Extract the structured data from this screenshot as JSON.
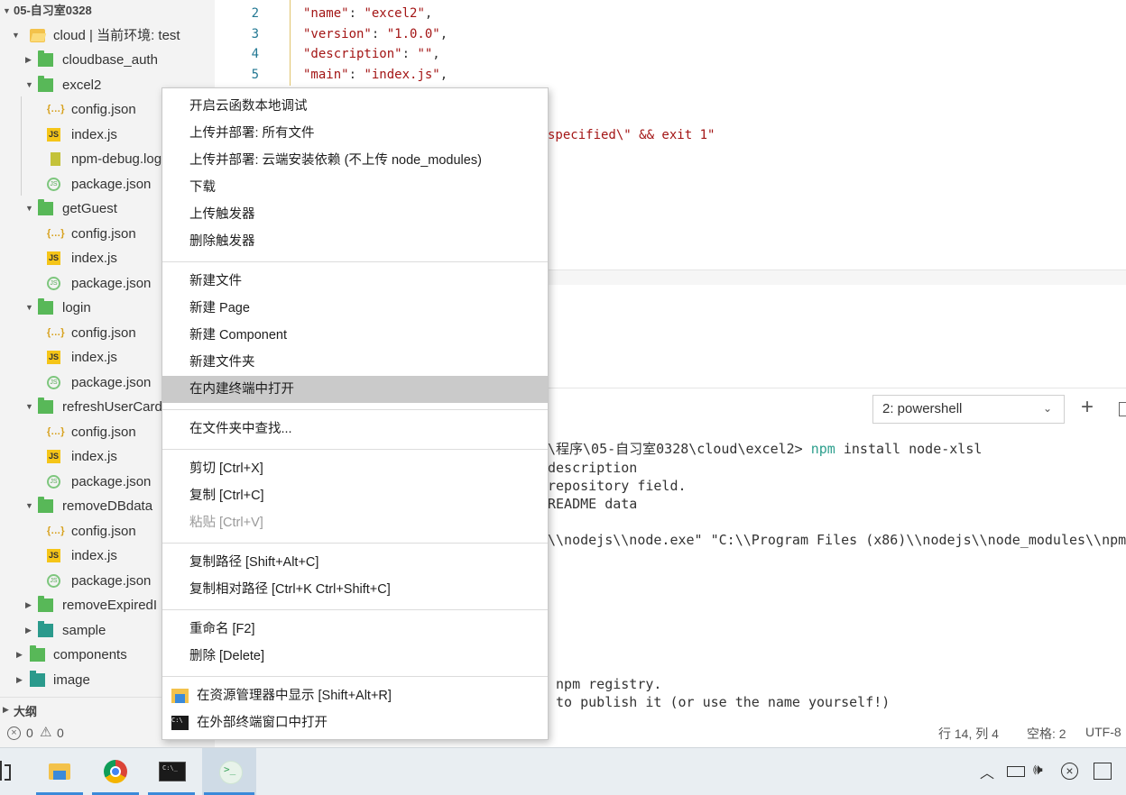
{
  "sidebar": {
    "project_title": "05-自习室0328",
    "cloud_root": "cloud | 当前环境: test",
    "items": [
      {
        "label": "cloudbase_auth"
      },
      {
        "label": "excel2"
      },
      {
        "label": "config.json"
      },
      {
        "label": "index.js"
      },
      {
        "label": "npm-debug.log"
      },
      {
        "label": "package.json"
      },
      {
        "label": "getGuest"
      },
      {
        "label": "config.json"
      },
      {
        "label": "index.js"
      },
      {
        "label": "package.json"
      },
      {
        "label": "login"
      },
      {
        "label": "config.json"
      },
      {
        "label": "index.js"
      },
      {
        "label": "package.json"
      },
      {
        "label": "refreshUserCard"
      },
      {
        "label": "config.json"
      },
      {
        "label": "index.js"
      },
      {
        "label": "package.json"
      },
      {
        "label": "removeDBdata"
      },
      {
        "label": "config.json"
      },
      {
        "label": "index.js"
      },
      {
        "label": "package.json"
      },
      {
        "label": "removeExpiredI"
      },
      {
        "label": "sample"
      },
      {
        "label": "components"
      },
      {
        "label": "image"
      }
    ],
    "outline_label": "大纲",
    "errors": "0",
    "warnings": "0"
  },
  "editor": {
    "lines": [
      {
        "num": "2",
        "key": "\"name\"",
        "val": "\"excel2\""
      },
      {
        "num": "3",
        "key": "\"version\"",
        "val": "\"1.0.0\""
      },
      {
        "num": "4",
        "key": "\"description\"",
        "val": "\"\""
      },
      {
        "num": "5",
        "key": "\"main\"",
        "val": "\"index.js\""
      }
    ],
    "partial_line": "specified\\\" && exit 1\""
  },
  "terminal": {
    "selector_value": "2: powershell",
    "add_symbol": "+",
    "lines": [
      {
        "prefix": "\\程序\\05-自习室0328\\cloud\\excel2> ",
        "cmd": "npm",
        "rest": " install node-xlsl"
      },
      {
        "prefix": "description",
        "cmd": "",
        "rest": ""
      },
      {
        "prefix": "repository field.",
        "cmd": "",
        "rest": ""
      },
      {
        "prefix": "README data",
        "cmd": "",
        "rest": ""
      },
      {
        "prefix": "\\\\nodejs\\\\node.exe\" \"C:\\\\Program Files (x86)\\\\nodejs\\\\node_modules\\\\npm",
        "cmd": "",
        "rest": ""
      },
      {
        "prefix": " npm registry.",
        "cmd": "",
        "rest": ""
      },
      {
        "prefix": " to publish it (or use the name yourself!)",
        "cmd": "",
        "rest": ""
      }
    ]
  },
  "statusbar": {
    "position": "行 14, 列 4",
    "spaces": "空格: 2",
    "encoding": "UTF-8"
  },
  "context_menu": {
    "groups": [
      [
        "开启云函数本地调试",
        "上传并部署: 所有文件",
        "上传并部署: 云端安装依赖 (不上传 node_modules)",
        "下载",
        "上传触发器",
        "删除触发器"
      ],
      [
        "新建文件",
        "新建 Page",
        "新建 Component",
        "新建文件夹",
        "在内建终端中打开"
      ],
      [
        "在文件夹中查找..."
      ],
      [
        "剪切  [Ctrl+X]",
        "复制  [Ctrl+C]",
        "粘贴  [Ctrl+V]"
      ],
      [
        "复制路径  [Shift+Alt+C]",
        "复制相对路径  [Ctrl+K Ctrl+Shift+C]"
      ],
      [
        "重命名  [F2]",
        "删除  [Delete]"
      ],
      [
        "在资源管理器中显示  [Shift+Alt+R]",
        "在外部终端窗口中打开"
      ]
    ],
    "highlighted": "在内建终端中打开",
    "disabled": "粘贴  [Ctrl+V]"
  },
  "colors": {
    "folder_green": "#58b858",
    "folder_yellow": "#f3c24b",
    "string_red": "#a31515",
    "highlight": "#cacaca",
    "npm_cmd": "#2d9f8d"
  }
}
